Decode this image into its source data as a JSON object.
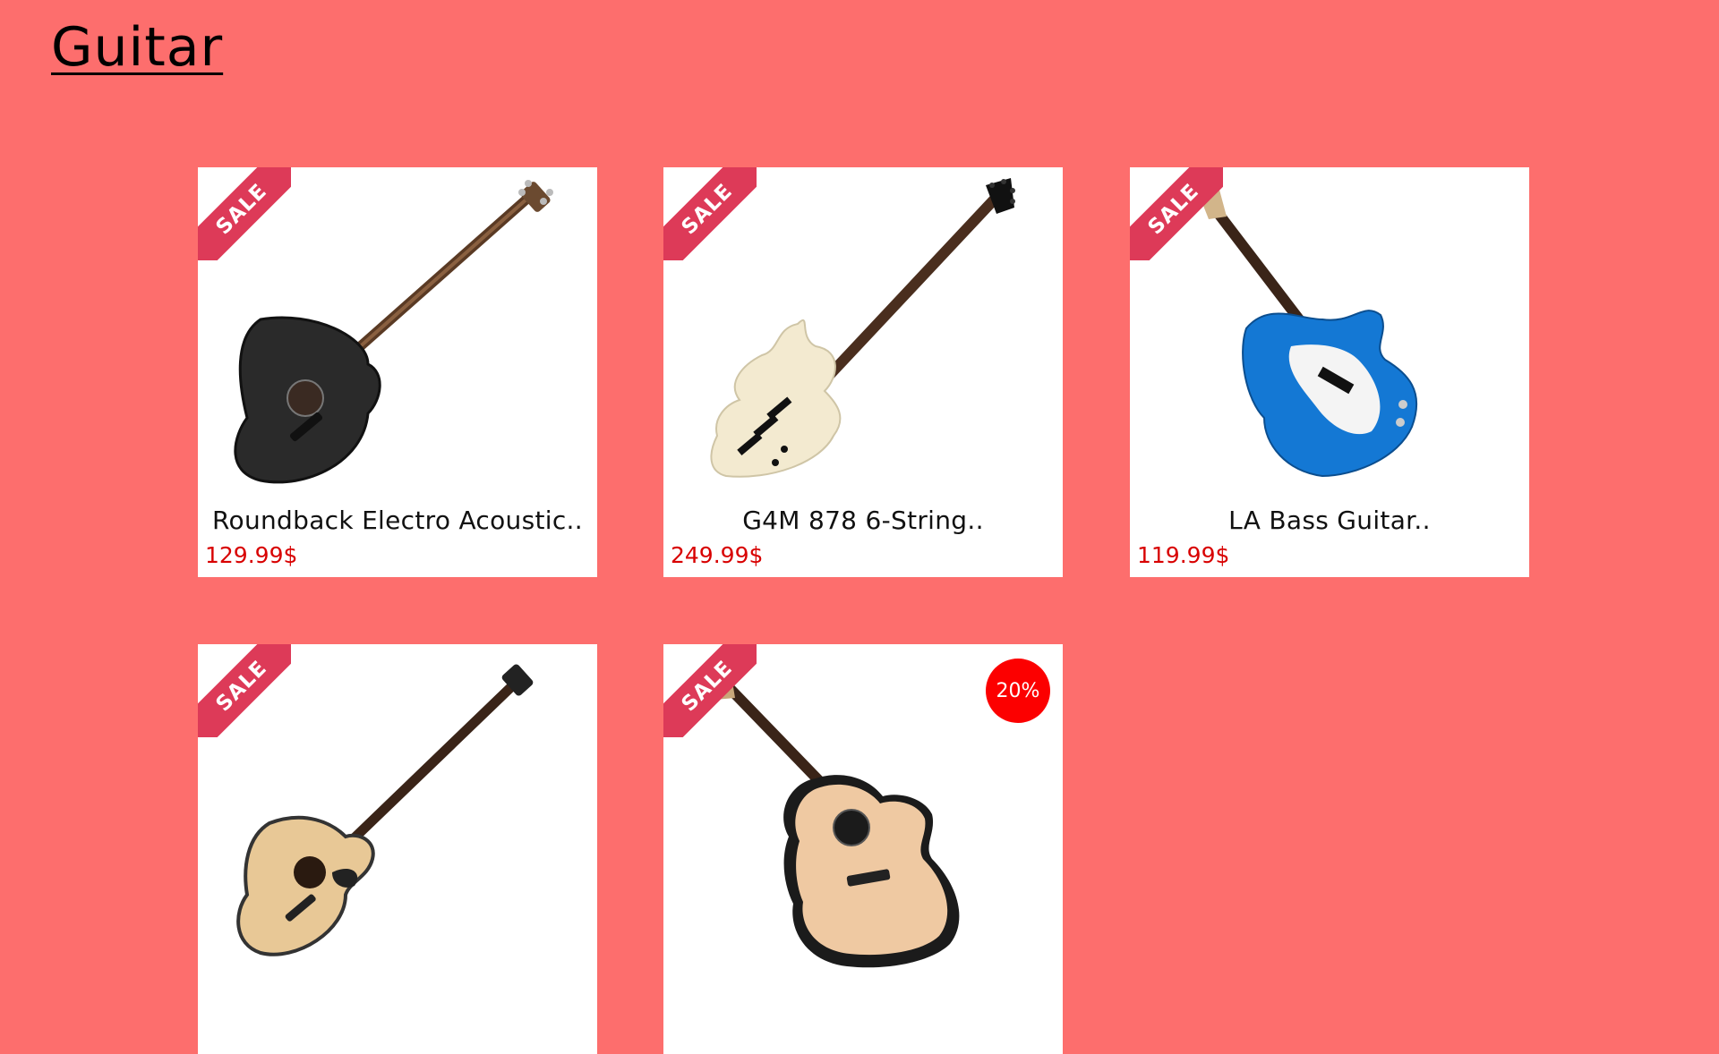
{
  "page": {
    "title": "Guitar",
    "background": "#fd6e6d"
  },
  "sale_ribbon_label": "SALE",
  "products": [
    {
      "name": "Roundback Electro Acoustic..",
      "price": "129.99$",
      "icon": "black-acoustic-bass-icon",
      "discount": ""
    },
    {
      "name": "G4M 878 6-String..",
      "price": "249.99$",
      "icon": "cream-6-string-bass-icon",
      "discount": ""
    },
    {
      "name": "LA Bass Guitar..",
      "price": "119.99$",
      "icon": "blue-bass-guitar-icon",
      "discount": ""
    },
    {
      "name": "",
      "price": "",
      "icon": "natural-acoustic-bass-icon",
      "discount": ""
    },
    {
      "name": "",
      "price": "",
      "icon": "spruce-acoustic-bass-icon",
      "discount": "20%"
    }
  ],
  "colors": {
    "ribbon": "#dd3a58",
    "price": "#d80000",
    "badge": "#fc0000"
  }
}
